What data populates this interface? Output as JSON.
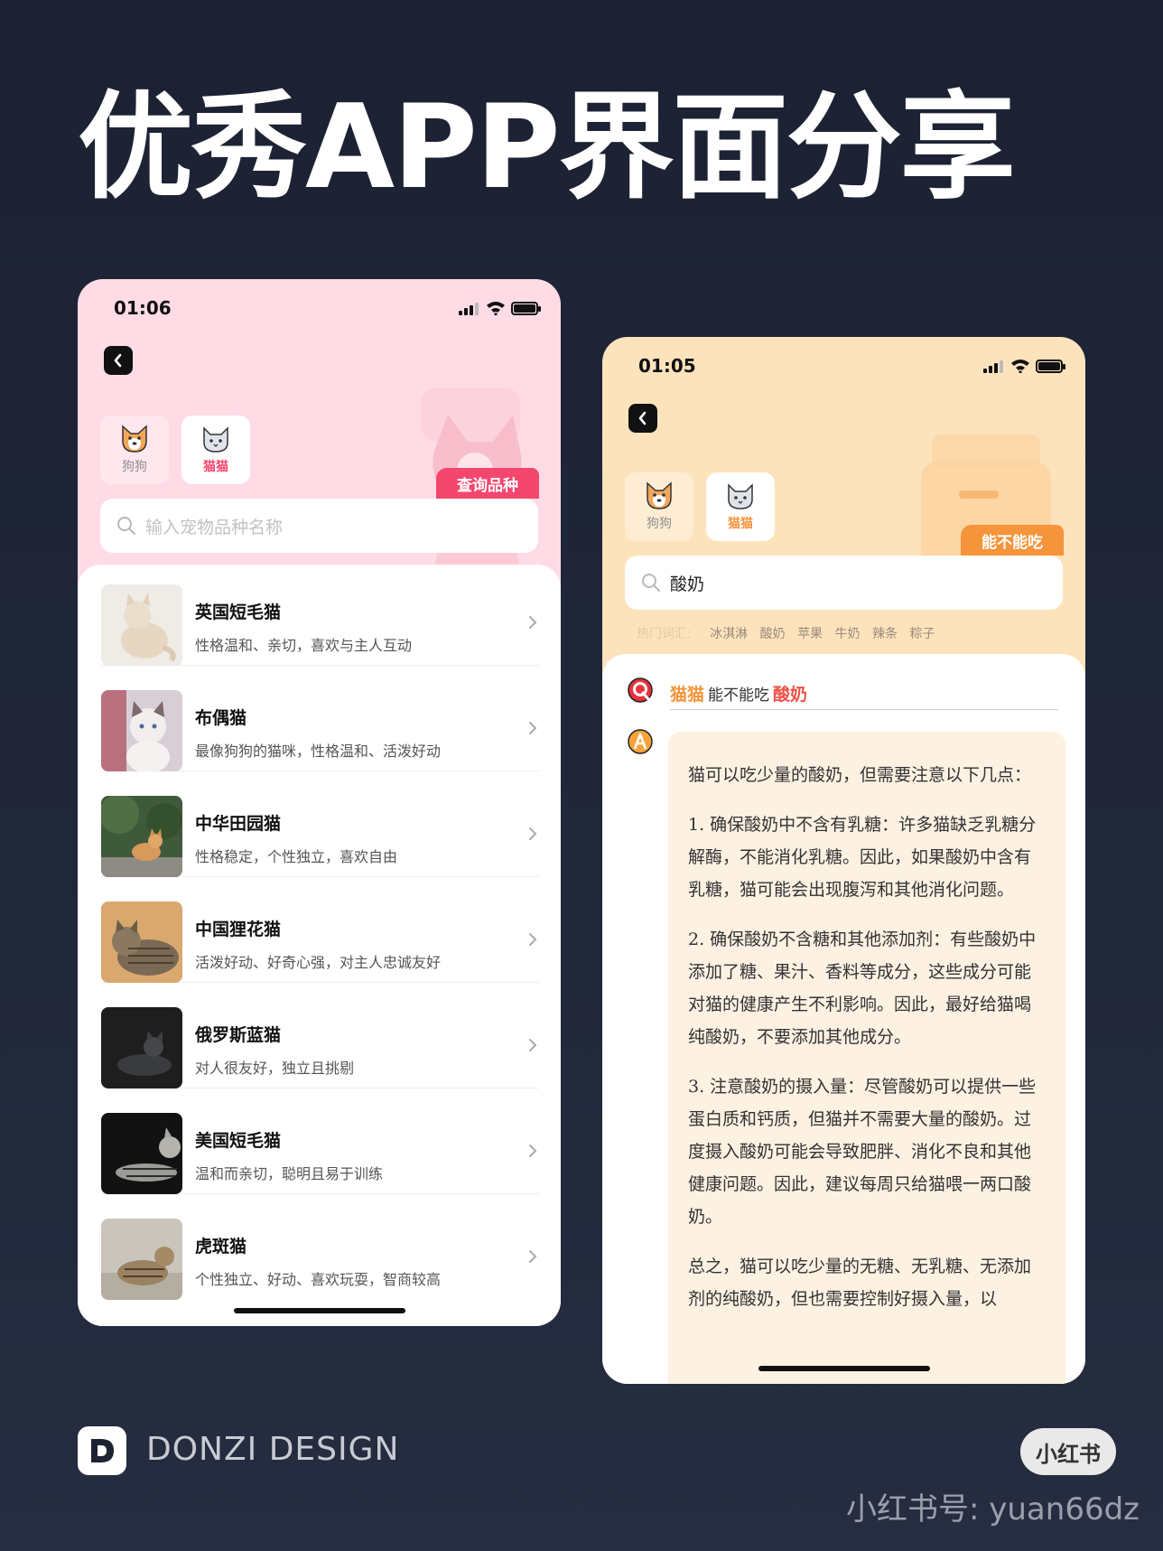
{
  "headline": "优秀APP界面分享",
  "left_screen": {
    "status_time": "01:06",
    "tabs": [
      {
        "label": "狗狗",
        "active": false
      },
      {
        "label": "猫猫",
        "active": true
      }
    ],
    "ribbon_label": "查询品种",
    "search_placeholder": "输入宠物品种名称",
    "breeds": [
      {
        "name": "英国短毛猫",
        "desc": "性格温和、亲切，喜欢与主人互动"
      },
      {
        "name": "布偶猫",
        "desc": "最像狗狗的猫咪，性格温和、活泼好动"
      },
      {
        "name": "中华田园猫",
        "desc": "性格稳定，个性独立，喜欢自由"
      },
      {
        "name": "中国狸花猫",
        "desc": "活泼好动、好奇心强，对主人忠诚友好"
      },
      {
        "name": "俄罗斯蓝猫",
        "desc": "对人很友好，独立且挑剔"
      },
      {
        "name": "美国短毛猫",
        "desc": "温和而亲切，聪明且易于训练"
      },
      {
        "name": "虎斑猫",
        "desc": "个性独立、好动、喜欢玩耍，智商较高"
      }
    ],
    "accent": "#f4476e"
  },
  "right_screen": {
    "status_time": "01:05",
    "tabs": [
      {
        "label": "狗狗",
        "active": false
      },
      {
        "label": "猫猫",
        "active": true
      }
    ],
    "ribbon_label": "能不能吃",
    "search_value": "酸奶",
    "hot_label": "热门词汇:",
    "hot_words": [
      "冰淇淋",
      "酸奶",
      "苹果",
      "牛奶",
      "辣条",
      "粽子"
    ],
    "question": {
      "animal": "猫猫",
      "middle": "能不能吃",
      "food": "酸奶"
    },
    "answer_paragraphs": [
      "猫可以吃少量的酸奶，但需要注意以下几点：",
      "1. 确保酸奶中不含有乳糖：许多猫缺乏乳糖分解酶，不能消化乳糖。因此，如果酸奶中含有乳糖，猫可能会出现腹泻和其他消化问题。",
      "2. 确保酸奶不含糖和其他添加剂：有些酸奶中添加了糖、果汁、香料等成分，这些成分可能对猫的健康产生不利影响。因此，最好给猫喝纯酸奶，不要添加其他成分。",
      "3. 注意酸奶的摄入量：尽管酸奶可以提供一些蛋白质和钙质，但猫并不需要大量的酸奶。过度摄入酸奶可能会导致肥胖、消化不良和其他健康问题。因此，建议每周只给猫喂一两口酸奶。",
      "总之，猫可以吃少量的无糖、无乳糖、无添加剂的纯酸奶，但也需要控制好摄入量，以"
    ],
    "accent": "#f5943b"
  },
  "footer": {
    "brand": "DONZI DESIGN",
    "badge": "小红书",
    "account": "小红书号: yuan66dz"
  }
}
